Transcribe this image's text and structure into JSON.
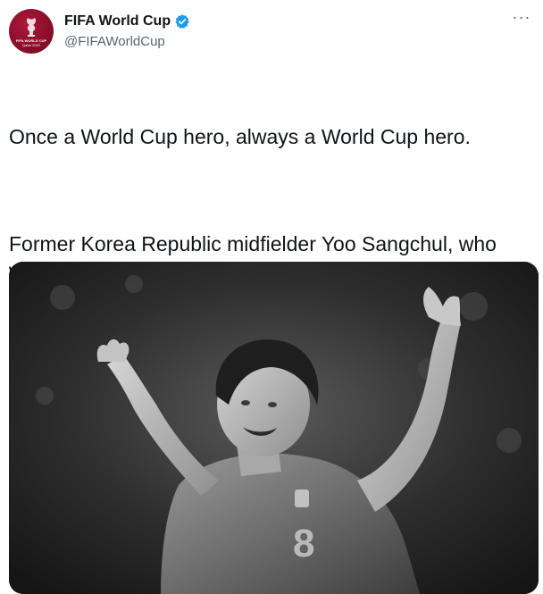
{
  "tweet": {
    "author": {
      "display_name": "FIFA World Cup",
      "handle": "@FIFAWorldCup",
      "verified": true,
      "avatar_icon": "fifa-world-cup-qatar-2022-logo",
      "avatar_text": "FIFA WORLD CUP Qatar 2022"
    },
    "more_label": "···",
    "text_paragraphs": [
      "Once a World Cup hero, always a World Cup hero.",
      "Former Korea Republic midfielder Yoo Sangchul, who was vital in the Taegeuk Warriors' run to the 2002 semi-finals on home soil, has passed away. Our thoughts are with his family, friends and the South Korean football community."
    ],
    "media": {
      "type": "photo",
      "style": "black-and-white"
    }
  },
  "colors": {
    "text_primary": "#0f1419",
    "text_secondary": "#536471",
    "verified_blue": "#1d9bf0",
    "avatar_maroon": "#8a0f2c"
  }
}
